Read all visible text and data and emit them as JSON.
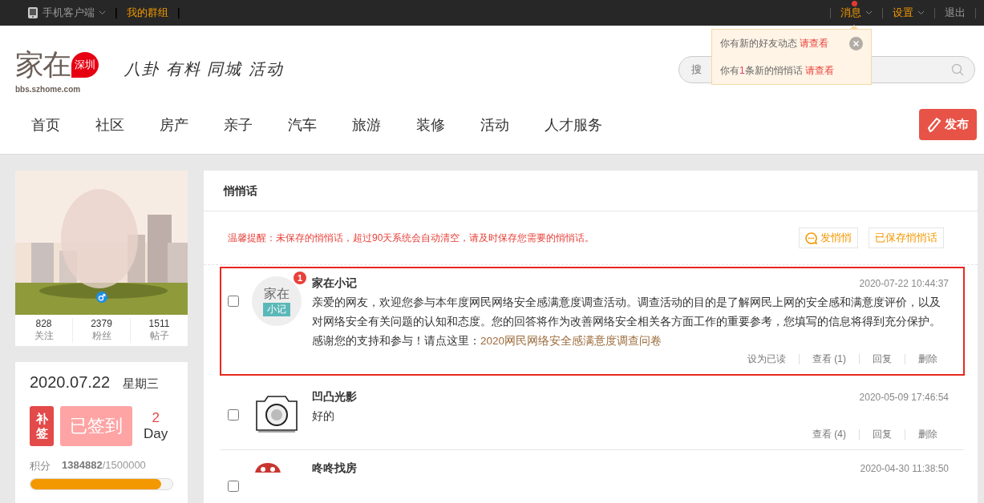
{
  "top_bar": {
    "left": [
      {
        "label": "手机客户端",
        "kind": "app",
        "notify": false
      },
      {
        "label": "我的群组",
        "kind": "link",
        "notify": false
      }
    ],
    "right": [
      {
        "label": "消息",
        "kind": "menu",
        "notify": true
      },
      {
        "label": "设置",
        "kind": "menu",
        "notify": false
      },
      {
        "label": "退出",
        "kind": "plain",
        "notify": false
      }
    ]
  },
  "popup": {
    "lines": [
      {
        "text": "你有新的好友动态",
        "link": "请查看"
      },
      {
        "text": "你有",
        "count": "1",
        "text_after": "条新的悄悄话",
        "link": "请查看"
      }
    ]
  },
  "header": {
    "logo": {
      "name": "家在",
      "city": "深圳",
      "domain": "bbs.szhome.com"
    },
    "slogan": "八卦 有料 同城 活动",
    "search": {
      "placeholder": "搜"
    },
    "nav": [
      "首页",
      "社区",
      "房产",
      "亲子",
      "汽车",
      "旅游",
      "装修",
      "活动",
      "人才服务"
    ],
    "publish": "发布"
  },
  "profile": {
    "stats": [
      {
        "value": "828",
        "label": "关注"
      },
      {
        "value": "2379",
        "label": "粉丝"
      },
      {
        "value": "1511",
        "label": "帖子"
      }
    ]
  },
  "signin": {
    "date": "2020.07.22",
    "weekday": "星期三",
    "makeup": "补签",
    "signed": "已签到",
    "streak": "2",
    "streak_unit": "Day",
    "points_label": "积分",
    "points": "1384882",
    "points_max": "/1500000",
    "level": 0.923
  },
  "panel": {
    "title": "悄悄话",
    "notice": "温馨提醒：未保存的悄悄话，超过90天系统会自动清空，请及时保存您需要的悄悄话。",
    "buttons": [
      {
        "label": "发悄悄",
        "kind": "compose"
      },
      {
        "label": "已保存悄悄话",
        "kind": "plain"
      }
    ],
    "messages": [
      {
        "sender": "家在小记",
        "kind": "logo",
        "avatar_lines": [
          "家在",
          "小记"
        ],
        "time": "2020-07-22 10:44:37",
        "badge": "1",
        "unread": true,
        "checked": false,
        "body": "亲爱的网友，欢迎您参与本年度网民网络安全感满意度调查活动。调查活动的目的是了解网民上网的安全感和满意度评价，以及对网络安全有关问题的认知和态度。您的回答将作为改善网络安全相关各方面工作的重要参考，您填写的信息将得到充分保护。感谢您的支持和参与！请点这里：",
        "link": "2020网民网络安全感满意度调查问卷",
        "actions": [
          "设为已读",
          "查看 (1)",
          "回复",
          "删除"
        ]
      },
      {
        "sender": "凹凸光影",
        "kind": "camera",
        "time": "2020-05-09 17:46:54",
        "unread": false,
        "checked": false,
        "body": "好的",
        "actions": [
          "查看 (4)",
          "回复",
          "删除"
        ]
      },
      {
        "sender": "咚咚找房",
        "kind": "lion",
        "time": "2020-04-30 11:38:50",
        "unread": false,
        "checked": false
      }
    ]
  }
}
